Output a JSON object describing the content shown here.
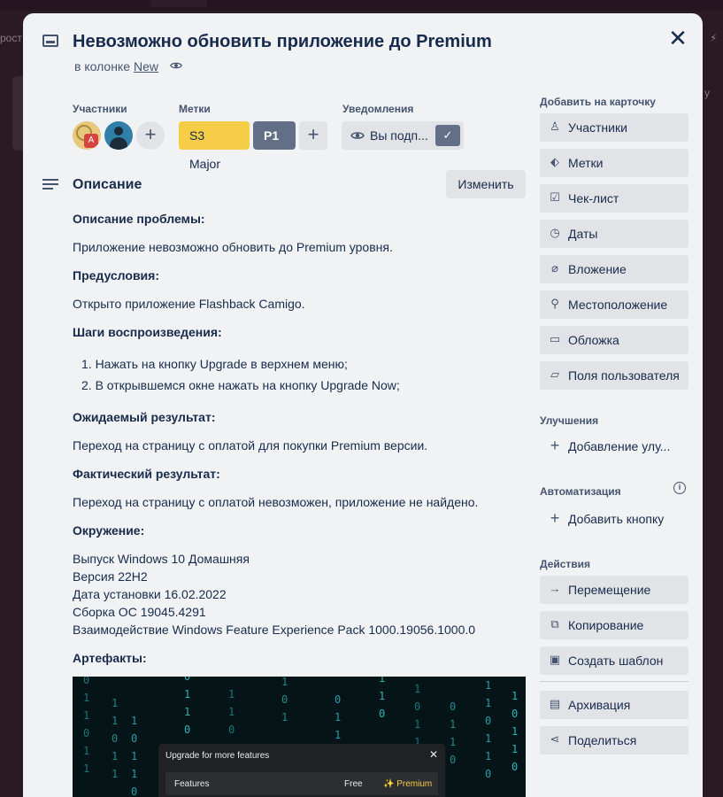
{
  "background": {
    "left_text": "рост",
    "right_text": "у"
  },
  "card": {
    "title": "Невозможно обновить приложение до  Premium",
    "in_column_prefix": "в колонке",
    "column_name": "New",
    "close_symbol": "✕"
  },
  "members": {
    "label": "Участники",
    "add_symbol": "+"
  },
  "labels": {
    "label": "Метки",
    "items": [
      "S3 Major",
      "P1"
    ],
    "add_symbol": "+"
  },
  "notifications": {
    "label": "Уведомления",
    "watch_text": "Вы подп...",
    "check_symbol": "✓"
  },
  "description": {
    "heading": "Описание",
    "edit_label": "Изменить",
    "problem_title": "Описание проблемы:",
    "problem_text": "Приложение невозможно обновить до Premium уровня.",
    "preconditions_title": "Предусловия:",
    "preconditions_text": "Открыто приложение Flashback Camigo.",
    "steps_title": "Шаги воспроизведения:",
    "steps": [
      "1. Нажать на кнопку Upgrade в верхнем меню;",
      "2. В открывшемся окне нажать на кнопку Upgrade Now;"
    ],
    "expected_title": "Ожидаемый результат:",
    "expected_text": "Переход на страницу с оплатой для покупки Premium версии.",
    "actual_title": "Фактический результат:",
    "actual_text": "Переход на страницу с оплатой невозможен, приложение не найдено.",
    "environment_title": "Окружение:",
    "environment": [
      "Выпуск Windows 10 Домашняя",
      "Версия 22H2",
      "Дата установки 16.02.2022",
      "Сборка ОС 19045.4291",
      "Взаимодействие Windows Feature Experience Pack 1000.19056.1000.0"
    ],
    "artifacts_title": "Артефакты:"
  },
  "artifact_image": {
    "dialog_title": "Upgrade for more features",
    "close_symbol": "✕",
    "col_features": "Features",
    "col_free": "Free",
    "col_premium": "✨ Premium"
  },
  "sidebar": {
    "add_to_card_label": "Добавить на карточку",
    "add_items": [
      {
        "icon": "person-icon",
        "glyph": "♙",
        "label": "Участники"
      },
      {
        "icon": "tag-icon",
        "glyph": "⬖",
        "label": "Метки"
      },
      {
        "icon": "checklist-icon",
        "glyph": "☑",
        "label": "Чек-лист"
      },
      {
        "icon": "clock-icon",
        "glyph": "◷",
        "label": "Даты"
      },
      {
        "icon": "paperclip-icon",
        "glyph": "⌀",
        "label": "Вложение"
      },
      {
        "icon": "location-pin-icon",
        "glyph": "⚲",
        "label": "Местоположение"
      },
      {
        "icon": "cover-icon",
        "glyph": "▭",
        "label": "Обложка"
      },
      {
        "icon": "custom-fields-icon",
        "glyph": "▱",
        "label": "Поля пользователя"
      }
    ],
    "powerups_label": "Улучшения",
    "powerup_add": {
      "glyph": "+",
      "label": "Добавление улу..."
    },
    "automation_label": "Автоматизация",
    "automation_info": "i",
    "automation_add": {
      "glyph": "+",
      "label": "Добавить кнопку"
    },
    "actions_label": "Действия",
    "actions": [
      {
        "icon": "arrow-right-icon",
        "glyph": "→",
        "label": "Перемещение"
      },
      {
        "icon": "copy-icon",
        "glyph": "⧉",
        "label": "Копирование"
      },
      {
        "icon": "template-icon",
        "glyph": "▣",
        "label": "Создать шаблон"
      }
    ],
    "archive": {
      "icon": "archive-icon",
      "glyph": "▤",
      "label": "Архивация"
    },
    "share": {
      "icon": "share-icon",
      "glyph": "⋖",
      "label": "Поделиться"
    }
  },
  "colors": {
    "modal_bg": "#f1f2f4",
    "button_bg": "#e2e3e6",
    "label_major": "#f5cd47",
    "label_p1": "#626f86"
  }
}
